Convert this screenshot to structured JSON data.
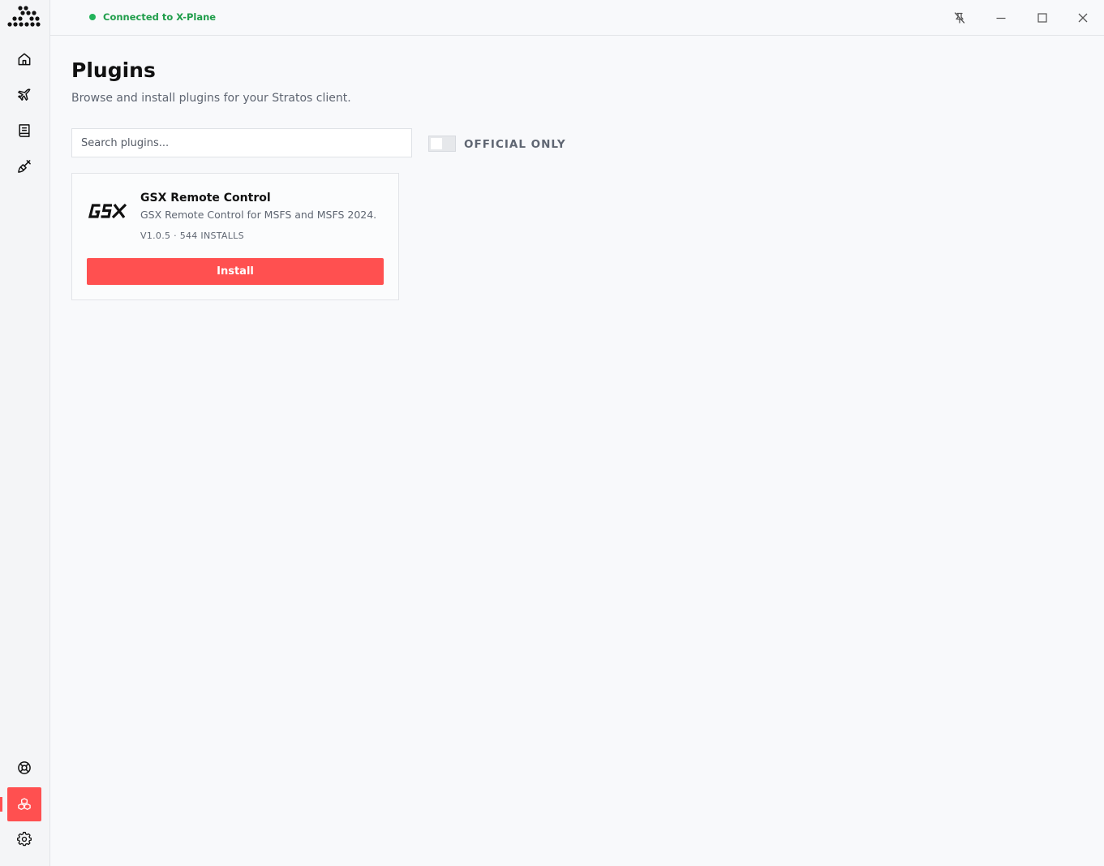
{
  "topbar": {
    "status_text": "Connected to X-Plane",
    "status_color": "#22b35a"
  },
  "sidebar": {
    "top_items": [
      {
        "name": "home",
        "icon": "home-icon"
      },
      {
        "name": "flights",
        "icon": "airplane-icon"
      },
      {
        "name": "logbook",
        "icon": "book-icon"
      },
      {
        "name": "liveries",
        "icon": "paint-brush-icon"
      }
    ],
    "bottom_items": [
      {
        "name": "support",
        "icon": "lifebuoy-icon"
      },
      {
        "name": "plugins",
        "icon": "cubes-icon",
        "active": true
      },
      {
        "name": "settings",
        "icon": "gear-icon"
      }
    ]
  },
  "window_controls": [
    "unpin-icon",
    "minimize-icon",
    "maximize-icon",
    "close-icon"
  ],
  "page": {
    "title": "Plugins",
    "subtitle": "Browse and install plugins for your Stratos client."
  },
  "search": {
    "placeholder": "Search plugins...",
    "value": ""
  },
  "filter": {
    "label": "OFFICIAL ONLY",
    "enabled": false
  },
  "plugins": [
    {
      "name": "GSX Remote Control",
      "description": "GSX Remote Control for MSFS and MSFS 2024.",
      "meta": "V1.0.5 · 544 INSTALLS",
      "button_label": "Install"
    }
  ],
  "colors": {
    "accent": "#ff5050",
    "status_green": "#22b35a"
  }
}
